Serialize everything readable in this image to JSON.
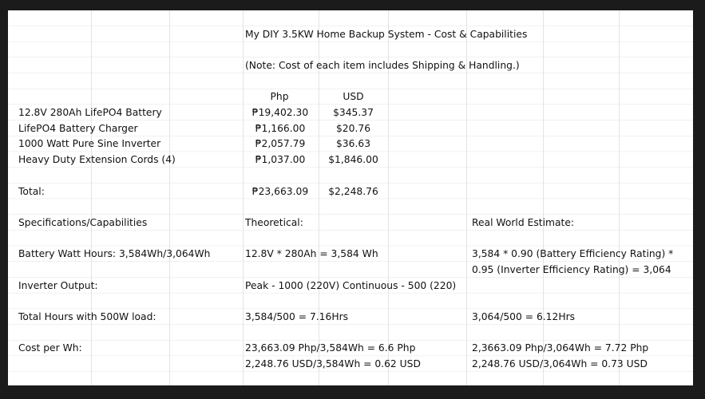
{
  "title": "My DIY 3.5KW Home Backup System - Cost & Capabilities",
  "note": "(Note: Cost of each item includes Shipping & Handling.)",
  "headers": {
    "php": "Php",
    "usd": "USD"
  },
  "items": [
    {
      "name": "12.8V 280Ah LifePO4 Battery",
      "php": "₱19,402.30",
      "usd": "$345.37"
    },
    {
      "name": "LifePO4 Battery Charger",
      "php": "₱1,166.00",
      "usd": "$20.76"
    },
    {
      "name": "1000 Watt Pure Sine Inverter",
      "php": "₱2,057.79",
      "usd": "$36.63"
    },
    {
      "name": "Heavy Duty Extension Cords (4)",
      "php": "₱1,037.00",
      "usd": "$1,846.00"
    }
  ],
  "total": {
    "label": "Total:",
    "php": "₱23,663.09",
    "usd": "$2,248.76"
  },
  "specs": {
    "label": "Specifications/Capabilities",
    "theoretical": "Theoretical:",
    "real": "Real World Estimate:"
  },
  "rows": {
    "battery_label": "Battery Watt Hours: 3,584Wh/3,064Wh",
    "battery_theory": "12.8V * 280Ah = 3,584 Wh",
    "battery_real_1": "3,584 * 0.90 (Battery Efficiency Rating) *",
    "battery_real_2": "0.95 (Inverter Efficiency Rating) = 3,064",
    "inverter_label": "Inverter Output:",
    "inverter_theory": "Peak - 1000 (220V) Continuous - 500 (220)",
    "hours_label": "Total Hours with 500W load:",
    "hours_theory": "3,584/500 = 7.16Hrs",
    "hours_real": "3,064/500 = 6.12Hrs",
    "cost_label": "Cost per Wh:",
    "cost_theory_1": "23,663.09 Php/3,584Wh = 6.6 Php",
    "cost_theory_2": "2,248.76 USD/3,584Wh = 0.62 USD",
    "cost_real_1": "2,3663.09 Php/3,064Wh = 7.72 Php",
    "cost_real_2": "2,248.76 USD/3,064Wh = 0.73 USD"
  }
}
